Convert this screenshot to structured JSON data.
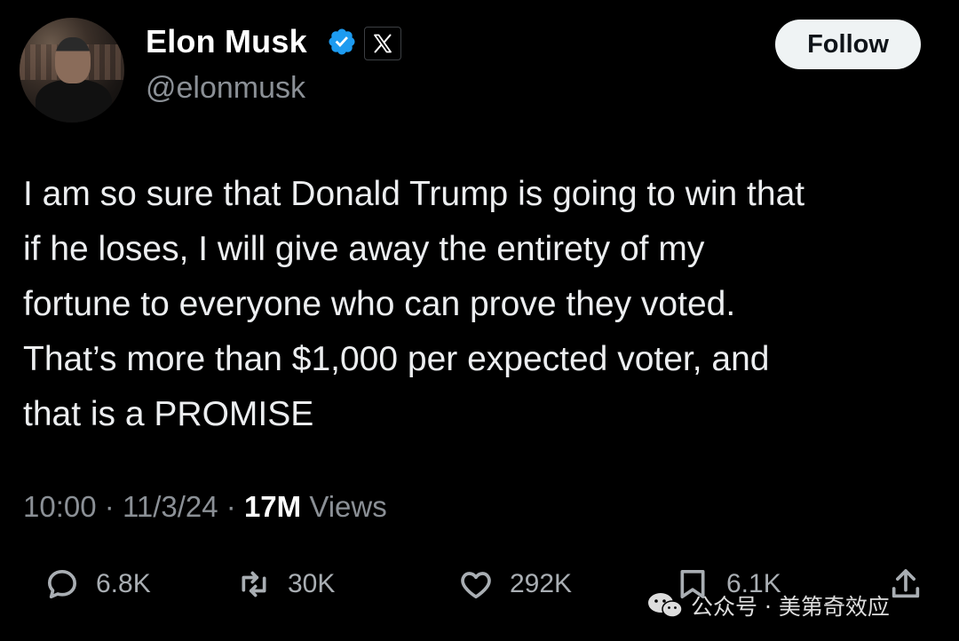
{
  "author": {
    "display_name": "Elon Musk",
    "handle": "@elonmusk",
    "verified_icon": "verified-badge-icon",
    "affiliation_icon": "x-logo-icon"
  },
  "follow_button": {
    "label": "Follow"
  },
  "tweet": {
    "lines": [
      "I am so sure that Donald Trump is going to win that",
      "if he loses, I will give away the entirety of my",
      "fortune to everyone who can prove they voted.",
      "That’s more than $1,000 per expected voter, and",
      "that is a PROMISE"
    ]
  },
  "meta": {
    "time": "10:00",
    "separator": "·",
    "date": "11/3/24",
    "views_count": "17M",
    "views_label": "Views"
  },
  "actions": {
    "replies": "6.8K",
    "reposts": "30K",
    "likes": "292K",
    "bookmarks": "6.1K"
  },
  "watermark": {
    "text": "公众号 · 美第奇效应"
  },
  "colors": {
    "background": "#000000",
    "text_primary": "#e7e9ea",
    "text_secondary": "#8b9096",
    "verified": "#1d9bf0",
    "follow_bg": "#eff3f4"
  }
}
